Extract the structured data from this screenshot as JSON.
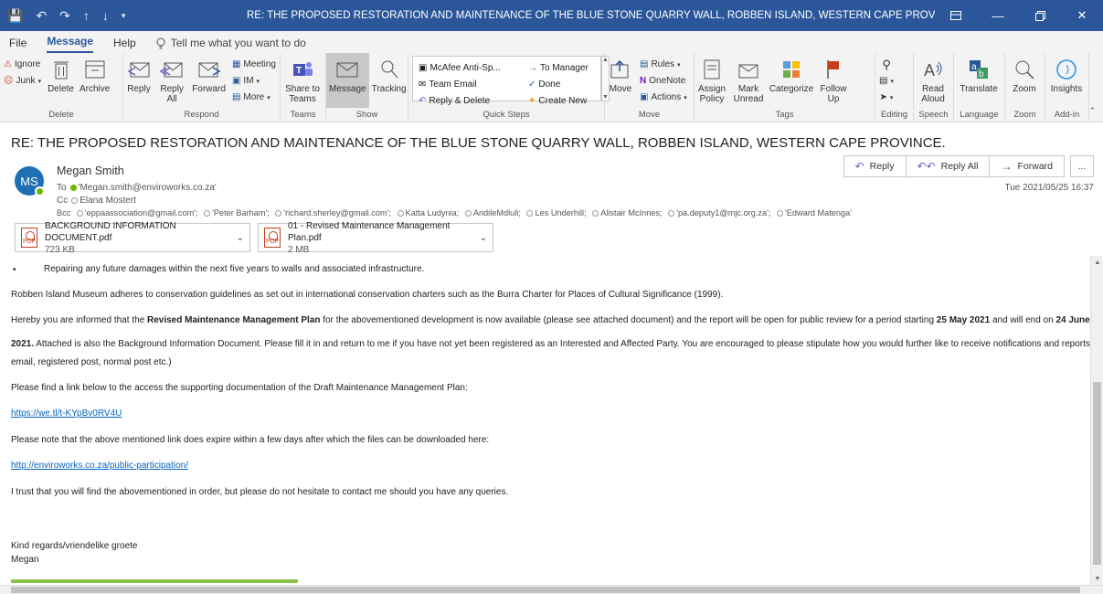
{
  "window": {
    "title": "RE: THE PROPOSED RESTORATION AND MAINTENANCE OF THE BLUE STONE QUARRY WALL, ROBBEN ISLAND, WESTERN CAPE PROVINCE.  - Message (HTML)",
    "quick_access": [
      "save",
      "undo",
      "redo",
      "up",
      "down",
      "customize"
    ],
    "controls": [
      "ribbon-display",
      "minimize",
      "restore",
      "close"
    ]
  },
  "menu": {
    "tabs": [
      "File",
      "Message",
      "Help"
    ],
    "active": "Message",
    "tell_me": "Tell me what you want to do"
  },
  "ribbon": {
    "delete": {
      "label": "Delete",
      "ignore": "Ignore",
      "junk": "Junk",
      "delete": "Delete",
      "archive": "Archive"
    },
    "respond": {
      "label": "Respond",
      "reply": "Reply",
      "reply_all": "Reply All",
      "forward": "Forward",
      "meeting": "Meeting",
      "im": "IM",
      "more": "More"
    },
    "teams": {
      "label": "Teams",
      "share": "Share to Teams"
    },
    "show": {
      "label": "Show",
      "message": "Message",
      "tracking": "Tracking"
    },
    "quick_steps": {
      "label": "Quick Steps",
      "items": [
        "McAfee Anti-Sp...",
        "To Manager",
        "Team Email",
        "Done",
        "Reply & Delete",
        "Create New"
      ]
    },
    "move": {
      "label": "Move",
      "move": "Move",
      "rules": "Rules",
      "onenote": "OneNote",
      "actions": "Actions"
    },
    "tags": {
      "label": "Tags",
      "assign_policy": "Assign Policy",
      "mark_unread": "Mark Unread",
      "categorize": "Categorize",
      "follow_up": "Follow Up"
    },
    "editing": {
      "label": "Editing"
    },
    "speech": {
      "label": "Speech",
      "read_aloud": "Read Aloud"
    },
    "language": {
      "label": "Language",
      "translate": "Translate"
    },
    "zoom": {
      "label": "Zoom",
      "zoom": "Zoom"
    },
    "addin": {
      "label": "Add-in",
      "insights": "Insights"
    }
  },
  "message": {
    "subject": "RE: THE PROPOSED RESTORATION AND MAINTENANCE OF THE BLUE STONE QUARRY WALL, ROBBEN ISLAND, WESTERN CAPE PROVINCE.",
    "avatar_initials": "MS",
    "sender": "Megan Smith",
    "to_label": "To",
    "to": "'Megan.smith@enviroworks.co.za'",
    "cc_label": "Cc",
    "cc": "Elana Mostert",
    "bcc_label": "Bcc",
    "bcc": [
      "'eppaassociation@gmail.com';",
      "'Peter Barham';",
      "'richard.sherley@gmail.com';",
      "Katta Ludynia;",
      "AndileMdluli;",
      "Les Underhill;",
      "Alistair McInnes;",
      "'pa.deputy1@mjc.org.za';",
      "'Edward Matenga'"
    ],
    "date": "Tue 2021/05/25 16:37",
    "actions": {
      "reply": "Reply",
      "reply_all": "Reply All",
      "forward": "Forward",
      "more": "..."
    },
    "attachments": [
      {
        "name": "BACKGROUND INFORMATION DOCUMENT.pdf",
        "size": "723 KB",
        "icon": "pdf-icon"
      },
      {
        "name": "01 - Revised Maintenance Management Plan.pdf",
        "size": "2 MB",
        "icon": "pdf-icon"
      }
    ]
  },
  "body": {
    "bullet": "Repairing any future damages within the next five years to walls and associated infrastructure.",
    "para1": "Robben Island Museum adheres to conservation guidelines as set out in international conservation charters such as the Burra Charter for Places of Cultural Significance (1999).",
    "para2_a": "Hereby you are informed that the ",
    "para2_bold1": "Revised Maintenance Management Plan",
    "para2_b": " for the abovementioned development is now available (please see attached document) and the report will be open for public review for a period starting ",
    "para2_bold2": "25 May 2021",
    "para2_c": " and will end on ",
    "para2_bold3": "24 June",
    "para2_line2_bold": "2021.",
    "para2_line2": "  Attached is also the Background Information Document. Please fill it in and return to me if you have not yet been registered as an Interested and Affected Party. You are encouraged to please stipulate how you would further like to receive notifications and reports (fax,",
    "para2_line3": "email, registered post, normal post etc.)",
    "para3": "Please find a link below to the access the supporting documentation of the Draft Maintenance Management Plan:",
    "link1": "https://we.tl/t-KYpBv0RV4U",
    "para4": "Please note that the above mentioned link does expire within a few days after which the files can be downloaded here:",
    "link2": "http://enviroworks.co.za/public-participation/",
    "para5": "I trust that you will find the abovementioned in order, but please do not hesitate to contact me should you have any queries.",
    "signoff": "Kind regards/vriendelike groete",
    "signature": "Megan"
  },
  "colors": {
    "titlebar": "#2b579a",
    "link": "#0563c1",
    "accent_green": "#8bc34a"
  }
}
